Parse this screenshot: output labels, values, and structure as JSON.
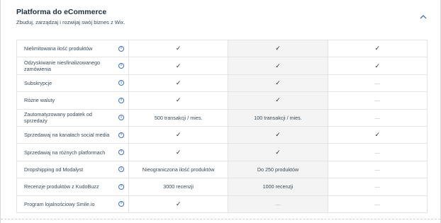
{
  "section": {
    "title": "Platforma do eCommerce",
    "subtitle": "Zbuduj, zarządzaj i rozwijaj swój biznes z Wix.",
    "collapse_icon": "chevron-up-icon",
    "accent_color": "#3b73c9"
  },
  "marks": {
    "check": "✓",
    "dash": "—",
    "info": "i"
  },
  "rows": [
    {
      "feature": "Nielimitowana ilość produktów",
      "values": [
        "check",
        "check",
        "check"
      ]
    },
    {
      "feature": "Odzyskiwanie niesfinalizowanego zamówienia",
      "values": [
        "check",
        "check",
        "check"
      ]
    },
    {
      "feature": "Subskrypcje",
      "values": [
        "check",
        "check",
        "dash"
      ]
    },
    {
      "feature": "Różne waluty",
      "values": [
        "check",
        "check",
        "dash"
      ]
    },
    {
      "feature": "Zautomatyzowany podatek od sprzedaży",
      "values": [
        "500 transakcji / mies.",
        "100 transakcji / mies.",
        "dash"
      ]
    },
    {
      "feature": "Sprzedawaj na kanałach social media",
      "values": [
        "check",
        "check",
        "check"
      ]
    },
    {
      "feature": "Sprzedawaj na różnych platformach",
      "values": [
        "check",
        "check",
        "dash"
      ]
    },
    {
      "feature": "Dropshipping od Modalyst",
      "values": [
        "Nieograniczona ilość produktów",
        "Do 250 produktów",
        "dash"
      ]
    },
    {
      "feature": "Recenzje produktów z KudoBuzz",
      "values": [
        "3000 recenzji",
        "1000 recenzji",
        "dash"
      ]
    },
    {
      "feature": "Program lojalnościowy Smile.io",
      "values": [
        "check",
        "dash",
        "dash"
      ]
    }
  ]
}
